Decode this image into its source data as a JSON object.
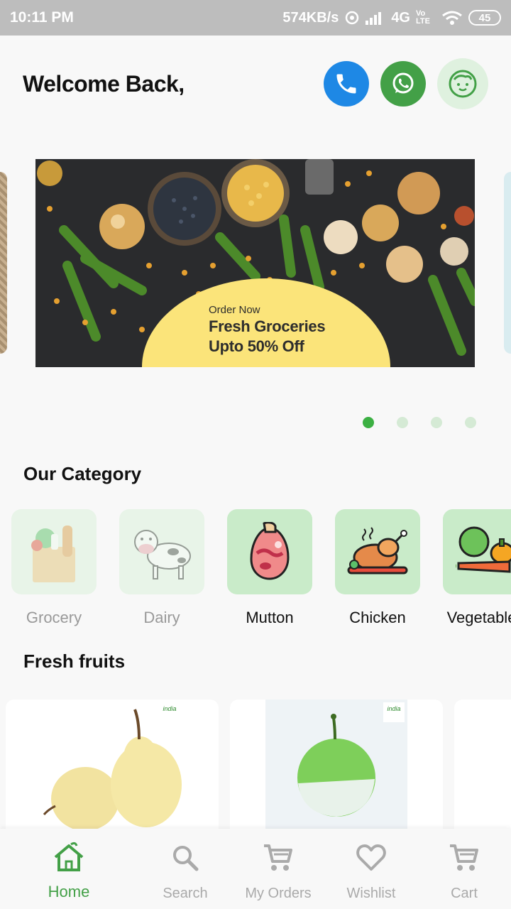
{
  "status_bar": {
    "time": "10:11 PM",
    "speed": "574KB/s",
    "network": "4G",
    "carrier": "Vo LTE",
    "battery": "45"
  },
  "header": {
    "greeting": "Welcome Back,",
    "phone_icon": "phone-icon",
    "whatsapp_icon": "whatsapp-icon",
    "profile_icon": "face-icon"
  },
  "banner": {
    "subtitle": "Order Now",
    "line1": "Fresh Groceries",
    "line2": "Upto 50% Off",
    "accent": "#fbe47a"
  },
  "carousel": {
    "slide_count": 4,
    "active_index": 0
  },
  "categories": {
    "title": "Our Category",
    "items": [
      {
        "label": "Grocery",
        "icon": "grocery-bag-icon"
      },
      {
        "label": "Dairy",
        "icon": "cow-icon"
      },
      {
        "label": "Mutton",
        "icon": "meat-icon"
      },
      {
        "label": "Chicken",
        "icon": "roast-chicken-icon"
      },
      {
        "label": "Vegetables",
        "icon": "vegetables-icon"
      }
    ]
  },
  "fruits": {
    "title": "Fresh fruits",
    "badge": "india"
  },
  "bottom_nav": {
    "items": [
      {
        "label": "Home",
        "icon": "home-icon",
        "active": true
      },
      {
        "label": "Search",
        "icon": "search-icon",
        "active": false
      },
      {
        "label": "My Orders",
        "icon": "cart-icon",
        "active": false
      },
      {
        "label": "Wishlist",
        "icon": "heart-icon",
        "active": false
      },
      {
        "label": "Cart",
        "icon": "cart-icon",
        "active": false
      }
    ]
  },
  "colors": {
    "brand_green": "#43a047",
    "status_bar": "#bdbdbd",
    "phone_blue": "#1e88e5",
    "category_bg": "#c9ebc9"
  }
}
